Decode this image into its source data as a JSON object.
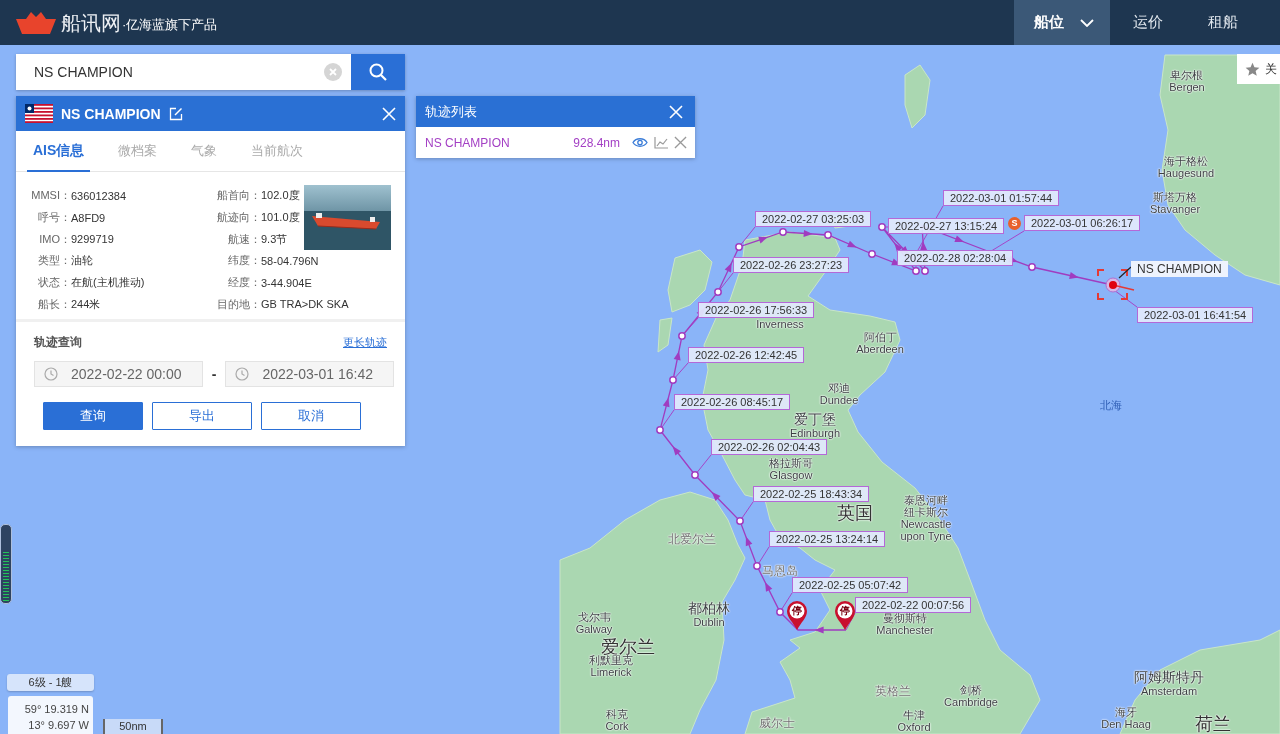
{
  "header": {
    "logo": {
      "brand": "船讯网",
      "tagline": "·亿海蓝旗下产品"
    },
    "nav": [
      {
        "label": "船位",
        "selected": true,
        "dropdown": true
      },
      {
        "label": "运价",
        "selected": false,
        "dropdown": false
      },
      {
        "label": "租船",
        "selected": false,
        "dropdown": false
      }
    ]
  },
  "search": {
    "value": "NS CHAMPION"
  },
  "vessel_panel": {
    "name": "NS CHAMPION",
    "tabs": [
      {
        "label": "AIS信息",
        "selected": true
      },
      {
        "label": "微档案",
        "selected": false
      },
      {
        "label": "气象",
        "selected": false
      },
      {
        "label": "当前航次",
        "selected": false
      }
    ],
    "fields": [
      {
        "label": "MMSI：",
        "value": "636012384"
      },
      {
        "label": "船首向：",
        "value": "102.0度"
      },
      {
        "label": "呼号：",
        "value": "A8FD9"
      },
      {
        "label": "航迹向：",
        "value": "101.0度"
      },
      {
        "label": "IMO：",
        "value": "9299719"
      },
      {
        "label": "航速：",
        "value": "9.3节"
      },
      {
        "label": "类型：",
        "value": "油轮"
      },
      {
        "label": "纬度：",
        "value": "58-04.796N"
      },
      {
        "label": "状态：",
        "value": "在航(主机推动)"
      },
      {
        "label": "经度：",
        "value": "3-44.904E"
      },
      {
        "label": "船长：",
        "value": "244米"
      },
      {
        "label": "目的地：",
        "value": "GB TRA>DK SKA"
      }
    ],
    "track_query": {
      "title": "轨迹查询",
      "link": "更长轨迹",
      "start": "2022-02-22 00:00",
      "separator": "-",
      "end": "2022-03-01 16:42",
      "buttons": [
        {
          "label": "查询",
          "kind": "primary"
        },
        {
          "label": "导出",
          "kind": "outline"
        },
        {
          "label": "取消",
          "kind": "outline"
        }
      ]
    }
  },
  "track_list": {
    "title": "轨迹列表",
    "rows": [
      {
        "name": "NS CHAMPION",
        "distance": "928.4nm"
      }
    ]
  },
  "follow_button": {
    "label": "关"
  },
  "map": {
    "places": [
      {
        "kind": "city",
        "name": "卑尔根",
        "latin": "Bergen"
      },
      {
        "kind": "city",
        "name": "海于格松",
        "latin": "Haugesund"
      },
      {
        "kind": "city",
        "name": "斯塔万格",
        "latin": "Stavanger"
      },
      {
        "kind": "city",
        "latin": "Inverness"
      },
      {
        "kind": "city",
        "name": "阿伯丁",
        "latin": "Aberdeen"
      },
      {
        "kind": "city",
        "name": "邓迪",
        "latin": "Dundee"
      },
      {
        "kind": "sea",
        "name": "北海"
      },
      {
        "kind": "capital",
        "name": "爱丁堡",
        "latin": "Edinburgh"
      },
      {
        "kind": "city",
        "name": "格拉斯哥",
        "latin": "Glasgow"
      },
      {
        "kind": "country",
        "name": "英国"
      },
      {
        "kind": "region",
        "name": "北爱尔兰"
      },
      {
        "kind": "city",
        "name": "泰恩河畔纽卡斯尔",
        "latin": "Newcastle upon Tyne"
      },
      {
        "kind": "region",
        "name": "马恩岛"
      },
      {
        "kind": "city",
        "name": "戈尔韦",
        "latin": "Galway"
      },
      {
        "kind": "capital",
        "name": "都柏林",
        "latin": "Dublin"
      },
      {
        "kind": "city",
        "name": "曼彻斯特",
        "latin": "Manchester"
      },
      {
        "kind": "country",
        "name": "爱尔兰"
      },
      {
        "kind": "city",
        "name": "利默里克",
        "latin": "Limerick"
      },
      {
        "kind": "region",
        "name": "英格兰"
      },
      {
        "kind": "city",
        "name": "剑桥",
        "latin": "Cambridge"
      },
      {
        "kind": "capital",
        "name": "阿姆斯特丹",
        "latin": "Amsterdam"
      },
      {
        "kind": "city",
        "name": "科克",
        "latin": "Cork"
      },
      {
        "kind": "region",
        "name": "威尔士"
      },
      {
        "kind": "city",
        "name": "牛津",
        "latin": "Oxford"
      },
      {
        "kind": "city",
        "name": "海牙",
        "latin": "Den Haag"
      },
      {
        "kind": "country",
        "name": "荷兰"
      }
    ],
    "track_labels": [
      {
        "time": "2022-03-01 01:57:44"
      },
      {
        "time": "2022-02-27 03:25:03"
      },
      {
        "time": "2022-02-27 13:15:24"
      },
      {
        "time": "2022-03-01 06:26:17",
        "badge": "S"
      },
      {
        "time": "2022-02-28 02:28:04"
      },
      {
        "time": "2022-02-26 23:27:23"
      },
      {
        "time": "2022-02-26 17:56:33"
      },
      {
        "time": "2022-02-26 12:42:45"
      },
      {
        "time": "2022-02-26 08:45:17"
      },
      {
        "time": "2022-02-26 02:04:43"
      },
      {
        "time": "2022-02-25 18:43:34"
      },
      {
        "time": "2022-02-25 13:24:14"
      },
      {
        "time": "2022-02-25 05:07:42"
      },
      {
        "time": "2022-02-22 00:07:56"
      },
      {
        "time": "2022-03-01 16:41:54"
      }
    ],
    "stops": [
      {
        "label": "停"
      },
      {
        "label": "停"
      }
    ],
    "vessel_label": "NS CHAMPION",
    "zoom_slider": {
      "level": 0.66
    },
    "level_info": "6级 - 1艘",
    "coordinates": {
      "lat": "59° 19.319 N",
      "lon": "13° 9.697 W"
    },
    "scale": "50nm"
  }
}
